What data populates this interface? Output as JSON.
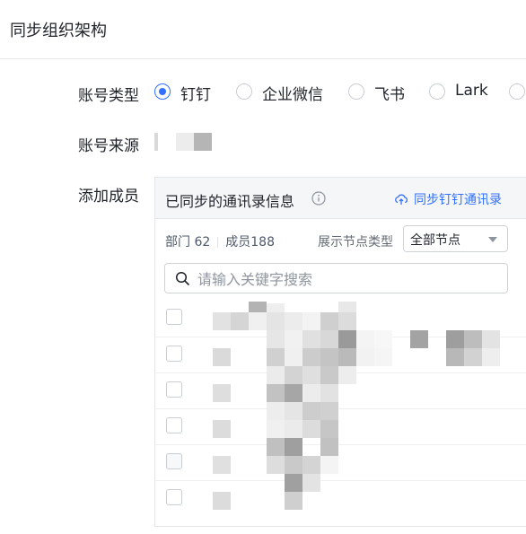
{
  "header": {
    "title": "同步组织架构"
  },
  "account_type": {
    "label": "账号类型",
    "options": [
      {
        "label": "钉钉",
        "selected": true
      },
      {
        "label": "企业微信",
        "selected": false
      },
      {
        "label": "飞书",
        "selected": false
      },
      {
        "label": "Lark",
        "selected": false
      }
    ]
  },
  "account_source": {
    "label": "账号来源"
  },
  "add_members": {
    "label": "添加成员",
    "panel": {
      "title": "已同步的通讯录信息",
      "sync_link": "同步钉钉通讯录",
      "stats": {
        "departments": "部门 62",
        "members": "成员188"
      },
      "node_type_label": "展示节点类型",
      "node_type_value": "全部节点",
      "search_placeholder": "请输入关键字搜索"
    }
  },
  "colors": {
    "accent": "#3370ff",
    "border": "#e5e6eb",
    "header_bg": "#f5f6f7"
  }
}
